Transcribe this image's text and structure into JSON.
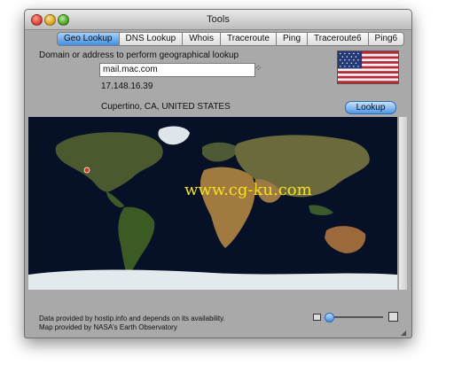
{
  "window": {
    "title": "Tools"
  },
  "tabs": [
    {
      "label": "Geo Lookup",
      "active": true
    },
    {
      "label": "DNS Lookup",
      "active": false
    },
    {
      "label": "Whois",
      "active": false
    },
    {
      "label": "Traceroute",
      "active": false
    },
    {
      "label": "Ping",
      "active": false
    },
    {
      "label": "Traceroute6",
      "active": false
    },
    {
      "label": "Ping6",
      "active": false
    }
  ],
  "form": {
    "prompt": "Domain or address to perform geographical lookup",
    "input_value": "mail.mac.com",
    "ip_address": "17.148.16.39",
    "location": "Cupertino, CA, UNITED STATES",
    "lookup_label": "Lookup",
    "flag": "us-flag"
  },
  "map": {
    "marker": "location-marker",
    "watermark": "www.cg-ku.com"
  },
  "footer": {
    "line1": "Data provided by hostip.info and depends on its availability.",
    "line2": "Map provided by NASA's Earth Observatory"
  },
  "colors": {
    "accent": "#4b98e8",
    "map_ocean": "#040a1a",
    "marker": "#e53424"
  }
}
